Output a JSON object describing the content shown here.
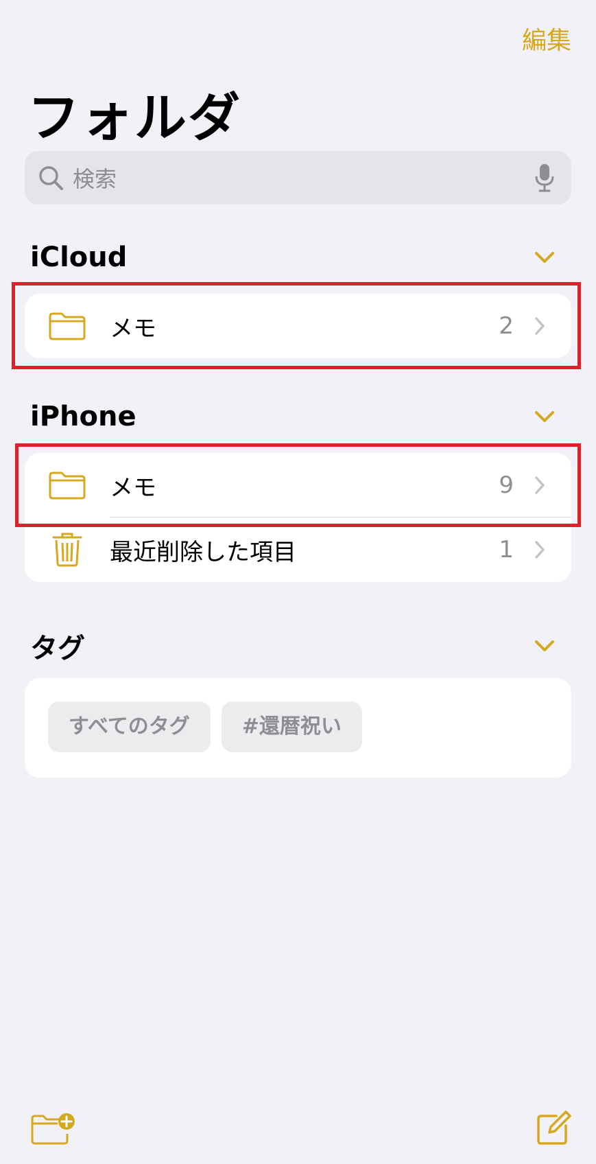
{
  "header": {
    "edit_label": "編集",
    "title": "フォルダ"
  },
  "search": {
    "placeholder": "検索"
  },
  "sections": {
    "icloud": {
      "title": "iCloud",
      "folders": [
        {
          "label": "メモ",
          "count": "2"
        }
      ]
    },
    "iphone": {
      "title": "iPhone",
      "folders": [
        {
          "label": "メモ",
          "count": "9"
        },
        {
          "label": "最近削除した項目",
          "count": "1"
        }
      ]
    },
    "tags": {
      "title": "タグ",
      "chips": [
        "すべてのタグ",
        "#還暦祝い"
      ]
    }
  },
  "icons": {
    "search": "search-icon",
    "mic": "mic-icon",
    "folder": "folder-icon",
    "trash": "trash-icon",
    "chevron_down": "chevron-down-icon",
    "chevron_right": "chevron-right-icon",
    "new_folder": "new-folder-icon",
    "compose": "compose-icon"
  },
  "colors": {
    "accent": "#d6a820",
    "background": "#f2f1f7",
    "highlight": "#e0202a"
  }
}
